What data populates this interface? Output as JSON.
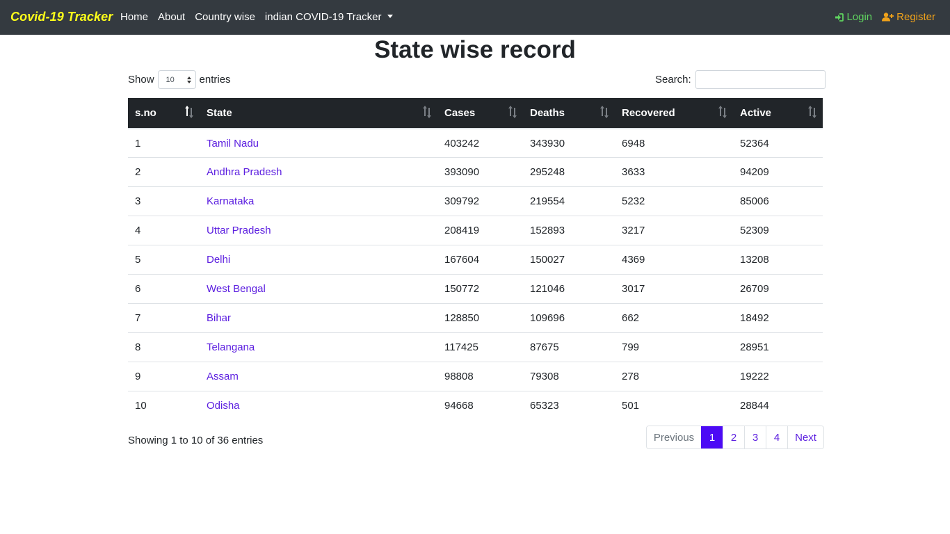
{
  "navbar": {
    "brand": "Covid-19 Tracker",
    "links": [
      "Home",
      "About",
      "Country wise",
      "indian COVID-19 Tracker"
    ],
    "login": "Login",
    "register": "Register"
  },
  "page_title": "State wise record",
  "controls": {
    "show_label": "Show",
    "entries_label": "entries",
    "page_length": "10",
    "search_label": "Search:",
    "search_value": ""
  },
  "table": {
    "columns": [
      "s.no",
      "State",
      "Cases",
      "Deaths",
      "Recovered",
      "Active"
    ],
    "rows": [
      [
        "1",
        "Tamil Nadu",
        "403242",
        "343930",
        "6948",
        "52364"
      ],
      [
        "2",
        "Andhra Pradesh",
        "393090",
        "295248",
        "3633",
        "94209"
      ],
      [
        "3",
        "Karnataka",
        "309792",
        "219554",
        "5232",
        "85006"
      ],
      [
        "4",
        "Uttar Pradesh",
        "208419",
        "152893",
        "3217",
        "52309"
      ],
      [
        "5",
        "Delhi",
        "167604",
        "150027",
        "4369",
        "13208"
      ],
      [
        "6",
        "West Bengal",
        "150772",
        "121046",
        "3017",
        "26709"
      ],
      [
        "7",
        "Bihar",
        "128850",
        "109696",
        "662",
        "18492"
      ],
      [
        "8",
        "Telangana",
        "117425",
        "87675",
        "799",
        "28951"
      ],
      [
        "9",
        "Assam",
        "98808",
        "79308",
        "278",
        "19222"
      ],
      [
        "10",
        "Odisha",
        "94668",
        "65323",
        "501",
        "28844"
      ]
    ]
  },
  "footer": {
    "info": "Showing 1 to 10 of 36 entries",
    "previous": "Previous",
    "pages": [
      "1",
      "2",
      "3",
      "4"
    ],
    "next": "Next"
  },
  "colors": {
    "navbar_bg": "#343a40",
    "brand": "#ffff1a",
    "login": "#5fd35f",
    "register": "#f0a21a",
    "link": "#5c1fe0",
    "active_page": "#4c0af5"
  }
}
